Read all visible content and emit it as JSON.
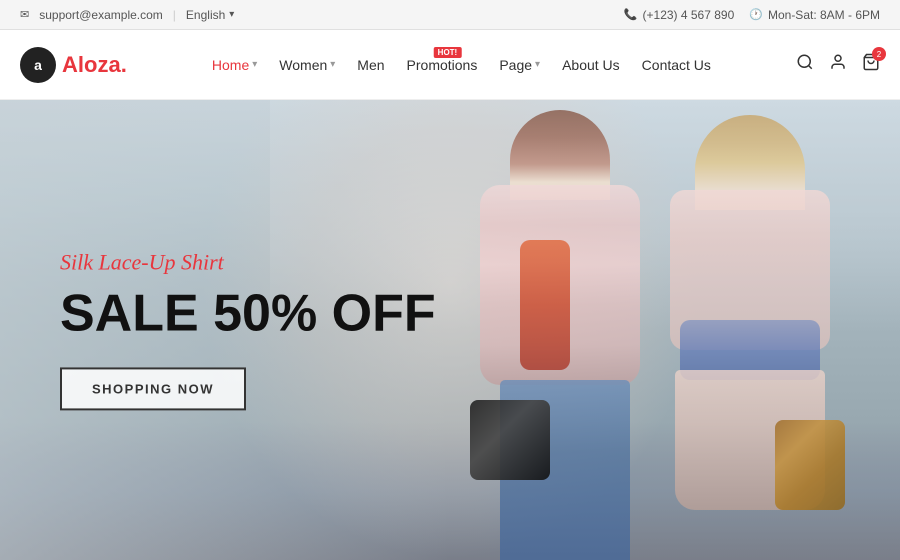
{
  "topbar": {
    "email": "support@example.com",
    "language": "English",
    "phone": "(+123) 4 567 890",
    "hours": "Mon-Sat: 8AM - 6PM"
  },
  "header": {
    "logo_letter": "a",
    "logo_name": "Aloza",
    "logo_dot": "."
  },
  "nav": {
    "items": [
      {
        "label": "Home",
        "has_arrow": true,
        "active": true
      },
      {
        "label": "Women",
        "has_arrow": true,
        "active": false
      },
      {
        "label": "Men",
        "has_arrow": false,
        "active": false
      },
      {
        "label": "Promotions",
        "has_arrow": false,
        "active": false,
        "badge": "HOT!"
      },
      {
        "label": "Page",
        "has_arrow": true,
        "active": false
      },
      {
        "label": "About Us",
        "has_arrow": false,
        "active": false
      },
      {
        "label": "Contact Us",
        "has_arrow": false,
        "active": false
      }
    ]
  },
  "hero": {
    "subtitle": "Silk Lace-Up Shirt",
    "title_line1": "SALE 50% OFF",
    "cta_label": "SHOPPING NOW",
    "cart_count": "2"
  }
}
